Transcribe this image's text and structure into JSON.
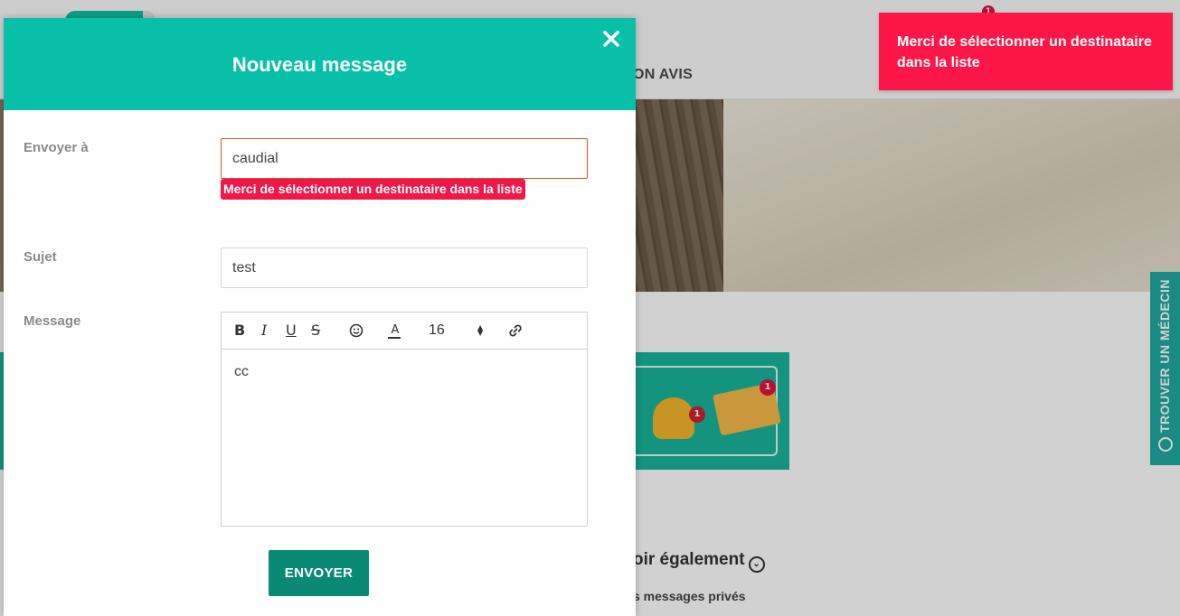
{
  "background": {
    "nav_item": "ON AVIS",
    "notification_count": "1",
    "banner_bell_count": "1",
    "banner_envelope_count": "1",
    "see_also": "oir également",
    "private_messages_link": "s messages privés",
    "side_tab_label": "TROUVER UN MÉDECIN"
  },
  "modal": {
    "title": "Nouveau message",
    "recipient": {
      "label": "Envoyer à",
      "value": "caudial",
      "error": "Merci de sélectionner un destinataire dans la liste"
    },
    "subject": {
      "label": "Sujet",
      "value": "test"
    },
    "message": {
      "label": "Message",
      "body": "cc",
      "toolbar": {
        "bold": "B",
        "italic": "I",
        "underline": "U",
        "strike": "S",
        "font_color": "A",
        "font_size": "16"
      }
    },
    "send_label": "ENVOYER"
  },
  "toast": {
    "message": "Merci de sélectionner un destinataire dans la liste"
  },
  "colors": {
    "modal_header": "#07c0a7",
    "send_button": "#0a8a74",
    "error": "#f0174a",
    "toast": "#fd1749"
  }
}
